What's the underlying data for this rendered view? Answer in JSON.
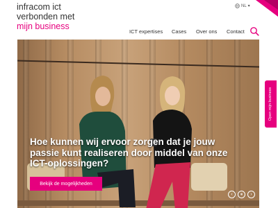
{
  "logo": {
    "line1": "infracom ict",
    "line2": "verbonden met",
    "line3": "mijn business"
  },
  "lang": {
    "label": "NL",
    "icon": "globe-icon"
  },
  "nav": {
    "items": [
      "ICT expertises",
      "Cases",
      "Over ons",
      "Contact"
    ]
  },
  "search": {
    "icon": "search-icon"
  },
  "hero": {
    "headline": "Hoe kunnen wij ervoor zorgen dat je jouw passie kunt realiseren door middel van onze ICT-oplossingen?",
    "cta": "Bekijk de mogelijkheden",
    "controls": {
      "prev": "‹",
      "pause": "⏸",
      "next": "›"
    }
  },
  "side_tab": {
    "label": "Open mijn business"
  },
  "colors": {
    "accent": "#e6007e"
  }
}
